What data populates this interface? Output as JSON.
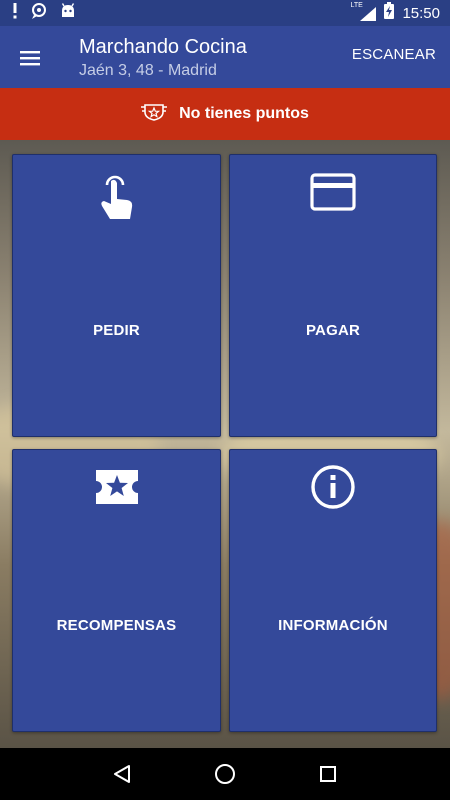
{
  "status_bar": {
    "time": "15:50",
    "network": "LTE",
    "icons": [
      "alert-icon",
      "chat-bubble-icon",
      "android-icon",
      "signal-icon",
      "battery-charging-icon"
    ]
  },
  "app_bar": {
    "title": "Marchando Cocina",
    "subtitle": "Jaén 3, 48 - Madrid",
    "action_label": "ESCANEAR"
  },
  "points_banner": {
    "text": "No tienes puntos",
    "icon": "badge-icon"
  },
  "tiles": [
    {
      "label": "PEDIR",
      "icon": "touch-hand-icon"
    },
    {
      "label": "PAGAR",
      "icon": "credit-card-icon"
    },
    {
      "label": "RECOMPENSAS",
      "icon": "star-ticket-icon"
    },
    {
      "label": "INFORMACIÓN",
      "icon": "info-icon"
    }
  ],
  "nav_bar": {
    "buttons": [
      "back-icon",
      "home-icon",
      "recents-icon"
    ]
  },
  "colors": {
    "primary": "#34499a",
    "status_bar": "#2a3f84",
    "banner": "#c62e12",
    "text": "#ffffff"
  }
}
